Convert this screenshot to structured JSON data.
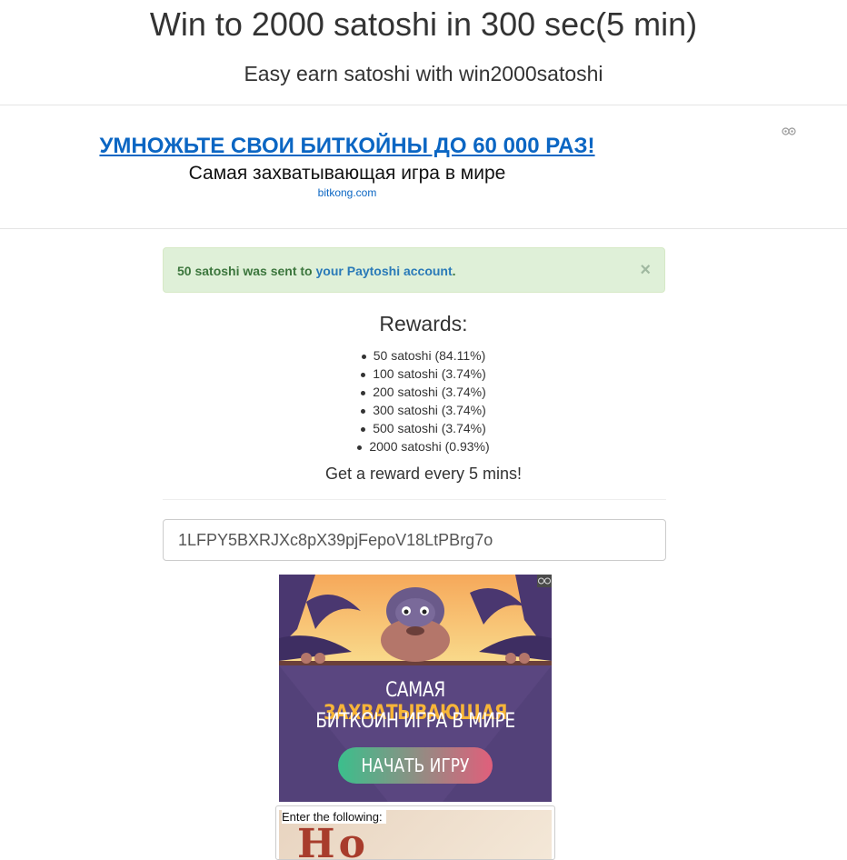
{
  "header": {
    "title": "Win to 2000 satoshi in 300 sec(5 min)",
    "subtitle": "Easy earn satoshi with win2000satoshi"
  },
  "text_ad": {
    "headline": "УМНОЖЬТЕ СВОИ БИТКОЙНЫ ДО 60 000 РАЗ!",
    "description": "Самая захватывающая игра в мире",
    "domain": "bitkong.com"
  },
  "alert": {
    "text_before": "50 satoshi was sent to ",
    "link_text": "your Paytoshi account",
    "text_after": ".",
    "close_symbol": "×",
    "color": "#dff0d8"
  },
  "rewards": {
    "title": "Rewards:",
    "items": [
      "50 satoshi (84.11%)",
      "100 satoshi (3.74%)",
      "200 satoshi (3.74%)",
      "300 satoshi (3.74%)",
      "500 satoshi (3.74%)",
      "2000 satoshi (0.93%)"
    ],
    "note": "Get a reward every 5 mins!"
  },
  "address_field": {
    "value": "1LFPY5BXRJXc8pX39pjFepoV18LtPBrg7o"
  },
  "banner_ad": {
    "line1_plain": "САМАЯ ",
    "line1_accent": "ЗАХВАТЫВАЮЩАЯ",
    "line2": "БИТКОИН ИГРА В МИРЕ",
    "cta": "НАЧАТЬ ИГРУ",
    "accent_color": "#f7b538",
    "background_color": "#5a4680"
  },
  "captcha": {
    "label": "Enter the following:",
    "glyph_hint": "Ho"
  }
}
